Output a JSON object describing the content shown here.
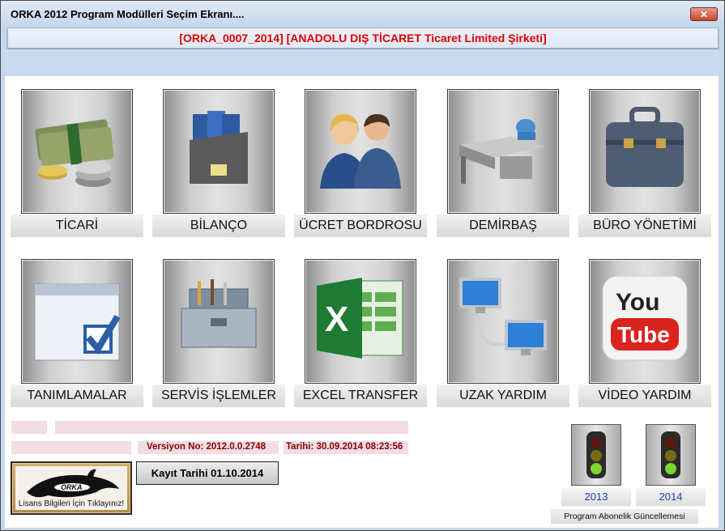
{
  "window": {
    "title": "ORKA 2012  Program Modülleri Seçim Ekranı....",
    "close_label": "✕",
    "company": "[ORKA_0007_2014] [ANADOLU DIŞ TİCARET Ticaret Limited Şirketi]"
  },
  "modules": [
    {
      "label": "TİCARİ",
      "icon": "money-stack-icon"
    },
    {
      "label": "BİLANÇO",
      "icon": "binders-icon"
    },
    {
      "label": "ÜCRET BORDROSU",
      "icon": "people-icon"
    },
    {
      "label": "DEMİRBAŞ",
      "icon": "office-desk-icon"
    },
    {
      "label": "BÜRO YÖNETİMİ",
      "icon": "briefcase-icon"
    },
    {
      "label": "TANIMLAMALAR",
      "icon": "window-checkbox-icon"
    },
    {
      "label": "SERVİS İŞLEMLER",
      "icon": "toolbox-icon"
    },
    {
      "label": "EXCEL TRANSFER",
      "icon": "excel-icon"
    },
    {
      "label": "UZAK YARDIM",
      "icon": "remote-computers-icon"
    },
    {
      "label": "VİDEO YARDIM",
      "icon": "youtube-icon"
    }
  ],
  "footer": {
    "version": "Versiyon No: 2012.0.0.2748",
    "date": "Tarihi: 30.09.2014 08:23:56",
    "kayit": "Kayıt Tarihi 01.10.2014",
    "logo_text": "ORKA",
    "license": "Lisans Bilgileri İçin Tıklayınız!",
    "year1": "2013",
    "year2": "2014",
    "subscription": "Program Abonelik Güncellemesi"
  }
}
